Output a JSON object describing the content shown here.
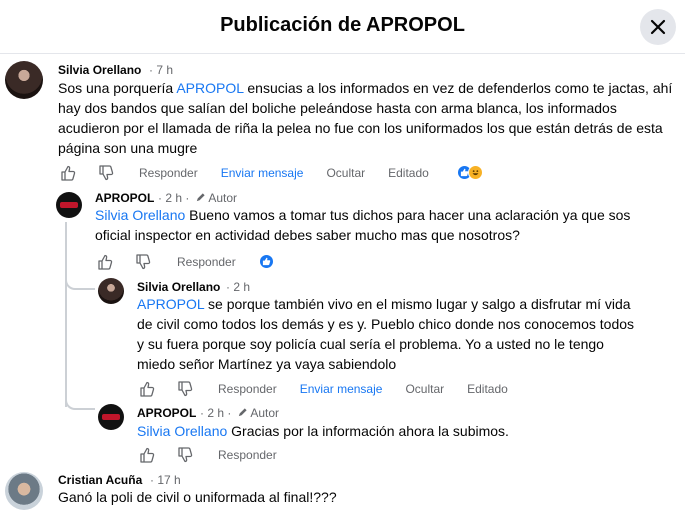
{
  "header": {
    "title": "Publicación de APROPOL"
  },
  "labels": {
    "reply": "Responder",
    "send_message": "Enviar mensaje",
    "hide": "Ocultar",
    "edited": "Editado",
    "author_badge": "Autor"
  },
  "comments": [
    {
      "author": "Silvia Orellano",
      "time": "· 7 h",
      "mention": "APROPOL",
      "text": " ensucias a los informados en vez de defenderlos como te jactas, ahí hay dos bandos que salían del boliche peleándose hasta con arma blanca, los informados acudieron por el llamada de riña la pelea no fue con los uniformados los que están detrás de esta página son una mugre",
      "prefix": "Sos una porquería "
    },
    {
      "author": "APROPOL",
      "time": "· 2 h ·",
      "mention": "Silvia Orellano",
      "text": " Bueno vamos a tomar tus dichos para hacer una aclaración ya que sos oficial inspector en actividad debes saber mucho mas que nosotros?"
    },
    {
      "author": "Silvia Orellano",
      "time": "· 2 h",
      "mention": "APROPOL",
      "text": " se porque también vivo en el mismo lugar y salgo a disfrutar mí vida de civil como todos los demás y es y. Pueblo chico donde nos conocemos todos y su fuera porque soy policía cual sería el problema. Yo a usted no le tengo miedo señor Martínez ya vaya sabiendolo"
    },
    {
      "author": "APROPOL",
      "time": "· 2 h ·",
      "mention": "Silvia Orellano",
      "text": " Gracias por la información ahora la subimos."
    },
    {
      "author": "Cristian Acuña",
      "time": "· 17 h",
      "text": "Ganó la poli de civil o uniformada al final!???"
    }
  ]
}
